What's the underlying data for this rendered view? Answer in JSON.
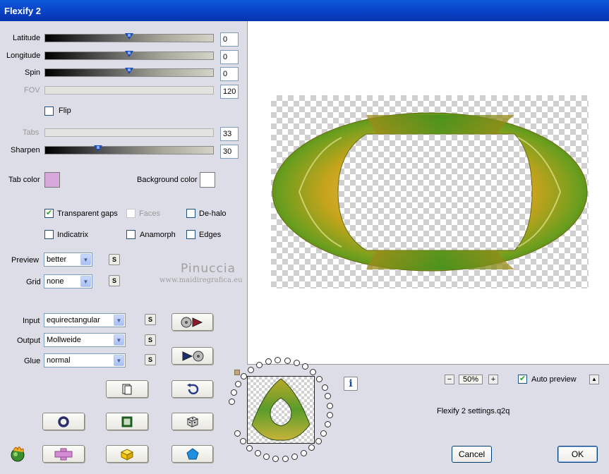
{
  "window": {
    "title": "Flexify 2"
  },
  "sliders": [
    {
      "label": "Latitude",
      "value": "0",
      "position": 0.5,
      "enabled": true
    },
    {
      "label": "Longitude",
      "value": "0",
      "position": 0.5,
      "enabled": true
    },
    {
      "label": "Spin",
      "value": "0",
      "position": 0.5,
      "enabled": true
    },
    {
      "label": "FOV",
      "value": "120",
      "enabled": false
    },
    {
      "label": "Tabs",
      "value": "33",
      "enabled": false
    },
    {
      "label": "Sharpen",
      "value": "30",
      "position": 0.31,
      "enabled": true
    }
  ],
  "flip": {
    "label": "Flip",
    "checked": false
  },
  "colors": {
    "tab_label": "Tab color",
    "tab_value": "#d8a8dc",
    "bg_label": "Background color",
    "bg_value": "#ffffff"
  },
  "options": {
    "transparent_gaps": {
      "label": "Transparent gaps",
      "checked": true
    },
    "faces": {
      "label": "Faces",
      "checked": false,
      "enabled": false
    },
    "dehalo": {
      "label": "De-halo",
      "checked": false
    },
    "indicatrix": {
      "label": "Indicatrix",
      "checked": false
    },
    "anamorph": {
      "label": "Anamorph",
      "checked": false
    },
    "edges": {
      "label": "Edges",
      "checked": false
    }
  },
  "selects": {
    "preview": {
      "label": "Preview",
      "value": "better",
      "s": "S"
    },
    "grid": {
      "label": "Grid",
      "value": "none",
      "s": "S"
    },
    "input": {
      "label": "Input",
      "value": "equirectangular",
      "s": "S"
    },
    "output": {
      "label": "Output",
      "value": "Mollweide",
      "s": "S"
    },
    "glue": {
      "label": "Glue",
      "value": "normal",
      "s": "S"
    }
  },
  "watermark": {
    "name": "Pinuccia",
    "site": "www.maidiregrafica.eu"
  },
  "tool_icons": [
    "play-forward-icon",
    "play-back-icon",
    "copy-page-icon",
    "undo-icon",
    "circle-icon",
    "square-icon",
    "dice-icon",
    "plugin-logo-icon",
    "cross-icon",
    "cube-icon",
    "pentagon-icon"
  ],
  "zoom": {
    "minus": "−",
    "value": "50%",
    "plus": "+"
  },
  "auto_preview": {
    "label": "Auto preview",
    "checked": true,
    "up": "▲"
  },
  "settings_file": "Flexify 2 settings.q2q",
  "info": "i",
  "buttons": {
    "cancel": "Cancel",
    "ok": "OK"
  }
}
